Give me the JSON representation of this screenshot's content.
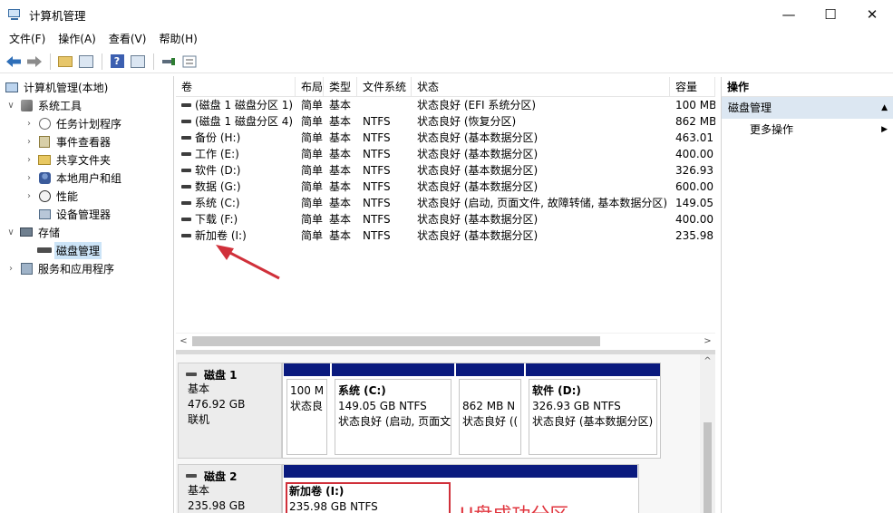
{
  "window": {
    "title": "计算机管理",
    "min_glyph": "—",
    "max_glyph": "☐",
    "close_glyph": "✕"
  },
  "menu": [
    "文件(F)",
    "操作(A)",
    "查看(V)",
    "帮助(H)"
  ],
  "toolbar": {
    "icons": [
      "back-arrow-icon",
      "forward-arrow-icon",
      "up-folder-icon",
      "show-hide-tree-icon",
      "help-icon",
      "properties-icon",
      "connect-icon",
      "list-view-icon"
    ],
    "help_glyph": "?"
  },
  "tree": [
    {
      "label": "计算机管理(本地)",
      "icon": "computer-icon",
      "level": 0,
      "expander": ""
    },
    {
      "label": "系统工具",
      "icon": "tools-icon",
      "level": 1,
      "expander": "∨"
    },
    {
      "label": "任务计划程序",
      "icon": "clock-icon",
      "level": 2,
      "expander": "›"
    },
    {
      "label": "事件查看器",
      "icon": "event-icon",
      "level": 2,
      "expander": "›"
    },
    {
      "label": "共享文件夹",
      "icon": "share-icon",
      "level": 2,
      "expander": "›"
    },
    {
      "label": "本地用户和组",
      "icon": "users-icon",
      "level": 2,
      "expander": "›"
    },
    {
      "label": "性能",
      "icon": "performance-icon",
      "level": 2,
      "expander": "›"
    },
    {
      "label": "设备管理器",
      "icon": "device-icon",
      "level": 2,
      "expander": ""
    },
    {
      "label": "存储",
      "icon": "storage-icon",
      "level": 1,
      "expander": "∨"
    },
    {
      "label": "磁盘管理",
      "icon": "disk-icon",
      "level": 2,
      "expander": "",
      "selected": true
    },
    {
      "label": "服务和应用程序",
      "icon": "service-icon",
      "level": 1,
      "expander": "›"
    }
  ],
  "volumes": {
    "columns": [
      "卷",
      "布局",
      "类型",
      "文件系统",
      "状态",
      "容量"
    ],
    "rows": [
      [
        "(磁盘 1 磁盘分区 1)",
        "简单",
        "基本",
        "",
        "状态良好 (EFI 系统分区)",
        "100 MB"
      ],
      [
        "(磁盘 1 磁盘分区 4)",
        "简单",
        "基本",
        "NTFS",
        "状态良好 (恢复分区)",
        "862 MB"
      ],
      [
        "备份 (H:)",
        "简单",
        "基本",
        "NTFS",
        "状态良好 (基本数据分区)",
        "463.01"
      ],
      [
        "工作 (E:)",
        "简单",
        "基本",
        "NTFS",
        "状态良好 (基本数据分区)",
        "400.00"
      ],
      [
        "软件 (D:)",
        "简单",
        "基本",
        "NTFS",
        "状态良好 (基本数据分区)",
        "326.93"
      ],
      [
        "数据 (G:)",
        "简单",
        "基本",
        "NTFS",
        "状态良好 (基本数据分区)",
        "600.00"
      ],
      [
        "系统 (C:)",
        "简单",
        "基本",
        "NTFS",
        "状态良好 (启动, 页面文件, 故障转储, 基本数据分区)",
        "149.05"
      ],
      [
        "下载 (F:)",
        "简单",
        "基本",
        "NTFS",
        "状态良好 (基本数据分区)",
        "400.00"
      ],
      [
        "新加卷 (I:)",
        "简单",
        "基本",
        "NTFS",
        "状态良好 (基本数据分区)",
        "235.98"
      ]
    ]
  },
  "disks": [
    {
      "name": "磁盘 1",
      "type": "基本",
      "size": "476.92 GB",
      "status": "联机",
      "partitions": [
        {
          "title": "",
          "line1": "100 M",
          "line2": "状态良"
        },
        {
          "title": "系统   (C:)",
          "line1": "149.05 GB NTFS",
          "line2": "状态良好 (启动, 页面文"
        },
        {
          "title": "",
          "line1": "862 MB N",
          "line2": "状态良好 (("
        },
        {
          "title": "软件   (D:)",
          "line1": "326.93 GB NTFS",
          "line2": "状态良好 (基本数据分区)"
        }
      ]
    },
    {
      "name": "磁盘 2",
      "type": "基本",
      "size": "235.98 GB",
      "status": "",
      "partitions": [
        {
          "title": "新加卷   (I:)",
          "line1": "235.98 GB NTFS",
          "line2": ""
        }
      ]
    }
  ],
  "annotation": "U盘成功分区",
  "actions": {
    "header": "操作",
    "section": "磁盘管理",
    "more": "更多操作",
    "section_glyph": "▲",
    "more_glyph": "▶"
  },
  "colors": {
    "partition_bar": "#0a1a7e",
    "annotation_red": "#e0343d",
    "selection": "#cce4f7"
  }
}
